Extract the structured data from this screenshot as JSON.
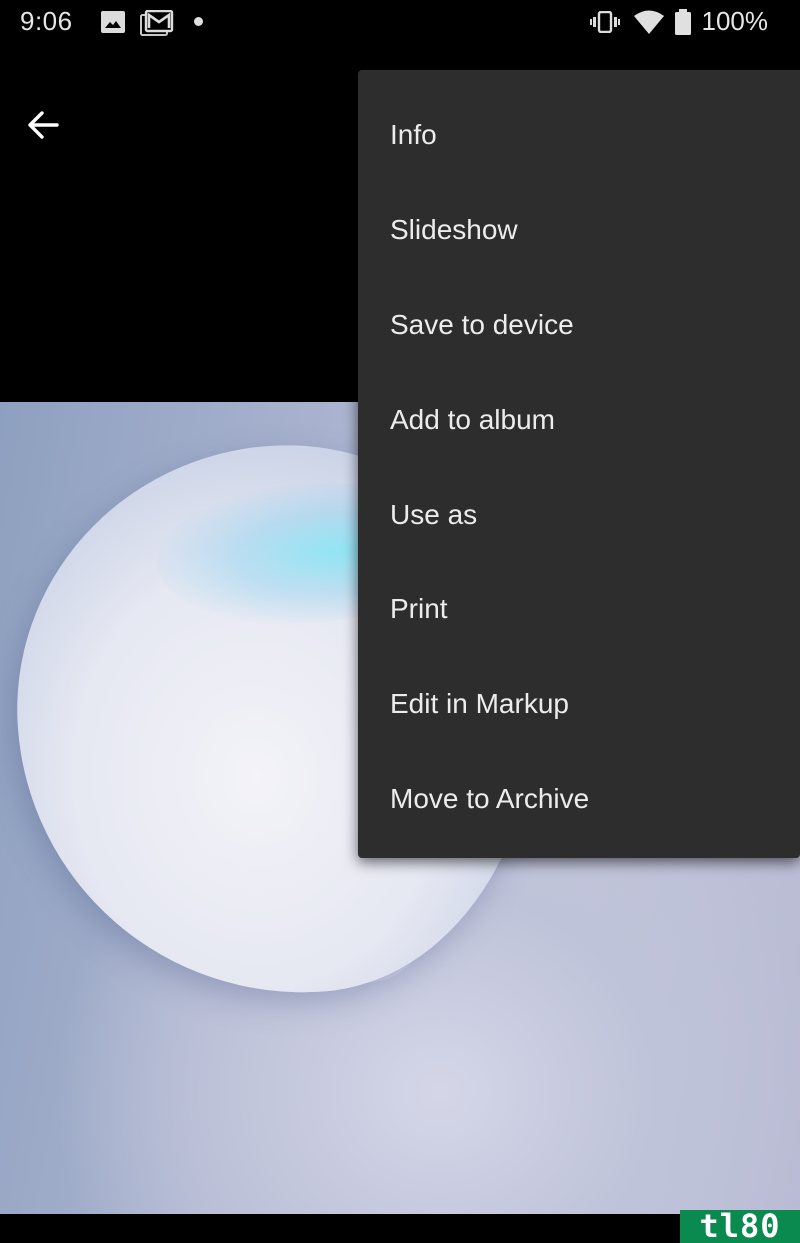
{
  "status_bar": {
    "time": "9:06",
    "notification_icons": [
      "photo-icon",
      "gmail-icon",
      "more-notifications-dot"
    ],
    "system_icons": [
      "vibrate-icon",
      "wifi-icon",
      "battery-icon"
    ],
    "battery_percent": "100%"
  },
  "toolbar": {
    "back_icon": "arrow-back-icon"
  },
  "overflow_menu": {
    "items": [
      {
        "label": "Info"
      },
      {
        "label": "Slideshow"
      },
      {
        "label": "Save to device"
      },
      {
        "label": "Add to album"
      },
      {
        "label": "Use as"
      },
      {
        "label": "Print"
      },
      {
        "label": "Edit in Markup"
      },
      {
        "label": "Move to Archive"
      }
    ]
  },
  "photo": {
    "description": "Abstract glossy white bubble on lavender-blue background"
  },
  "watermark": {
    "text": "tl80",
    "color": "#0b8a4f"
  },
  "colors": {
    "menu_background": "#2d2d2e",
    "menu_text": "#ececec",
    "app_background": "#000000"
  }
}
